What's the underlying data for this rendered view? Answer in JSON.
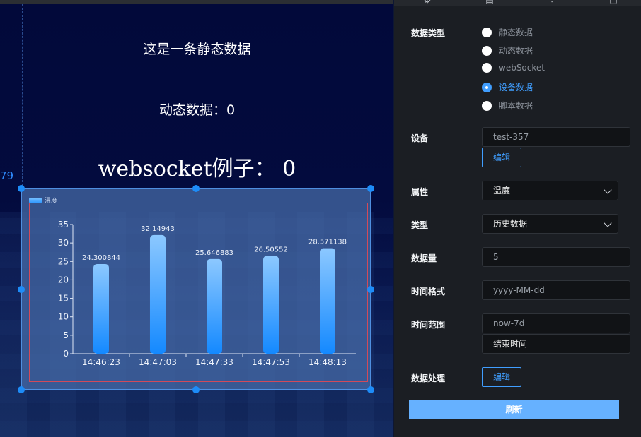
{
  "canvas": {
    "static_title": "这是一条静态数据",
    "dynamic_line": "动态数据：0",
    "websocket_line": "websocket例子：  0",
    "ruler_number": "79",
    "chart_legend": "温度"
  },
  "chart_data": {
    "type": "bar",
    "categories": [
      "14:46:23",
      "14:47:03",
      "14:47:33",
      "14:47:53",
      "14:48:13"
    ],
    "series": [
      {
        "name": "温度",
        "values": [
          24.300844,
          32.14943,
          25.646883,
          26.50552,
          28.571138
        ]
      }
    ],
    "value_labels": [
      "24.300844",
      "32.14943",
      "25.646883",
      "26.50552",
      "28.571138"
    ],
    "ylim": [
      0,
      35
    ],
    "yticks": [
      "0",
      "5",
      "10",
      "15",
      "20",
      "25",
      "30",
      "35"
    ],
    "legend": "top-left",
    "colors": {
      "bar_top": "#8cc8ff",
      "bar_bottom": "#1489ff"
    }
  },
  "panel": {
    "tabs": [
      {
        "icon": "gear-icon",
        "glyph": "⚙"
      },
      {
        "icon": "document-icon",
        "glyph": "▤"
      },
      {
        "icon": "sliders-icon",
        "glyph": "⫶"
      },
      {
        "icon": "square-icon",
        "glyph": "▢"
      }
    ],
    "data_type_label": "数据类型",
    "data_type_options": [
      "静态数据",
      "动态数据",
      "webSocket",
      "设备数据",
      "脚本数据"
    ],
    "data_type_selected": "设备数据",
    "device_label": "设备",
    "device_value": "test-357",
    "device_edit": "编辑",
    "attribute_label": "属性",
    "attribute_value": "温度",
    "type_label": "类型",
    "type_value": "历史数据",
    "count_label": "数据量",
    "count_value": "5",
    "time_format_label": "时间格式",
    "time_format_value": "yyyy-MM-dd",
    "time_range_label": "时间范围",
    "time_range_start": "now-7d",
    "time_range_end": "结束时间",
    "processing_label": "数据处理",
    "processing_edit": "编辑",
    "refresh": "刷新",
    "colors": {
      "accent": "#409eff",
      "refresh_bg": "#66b1ff"
    }
  }
}
